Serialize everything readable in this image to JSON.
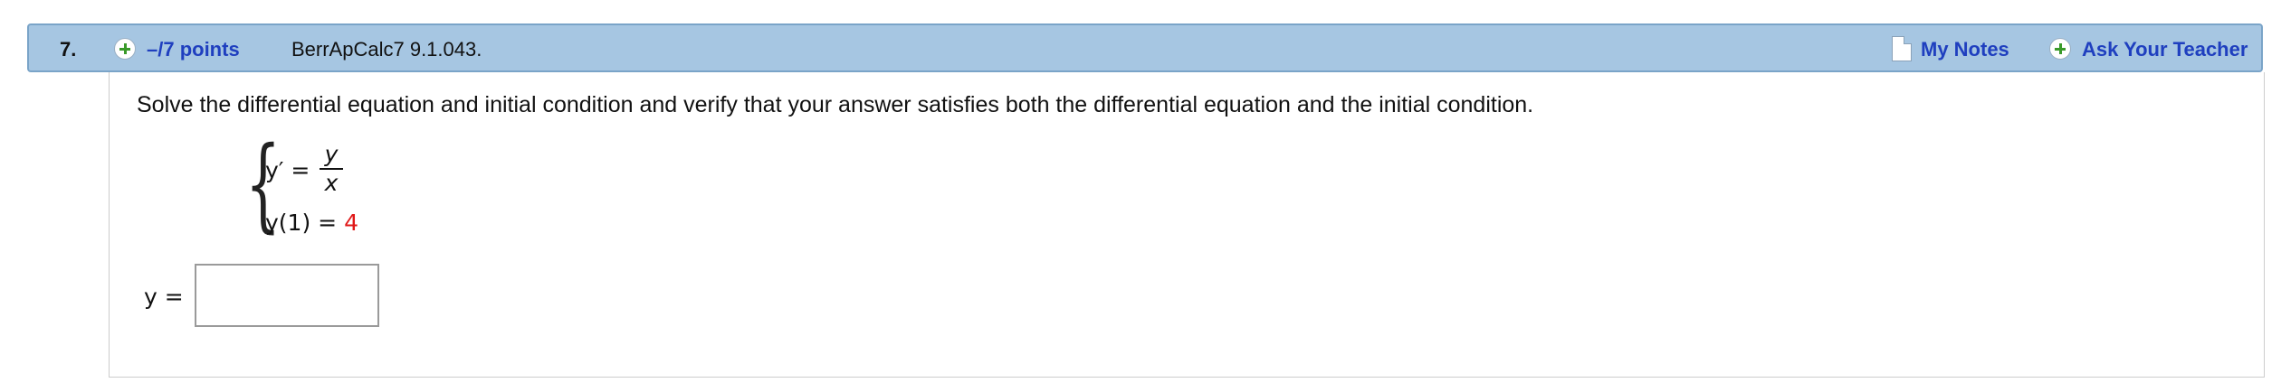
{
  "question": {
    "number": "7.",
    "points_label": "–/7 points",
    "source_id": "BerrApCalc7 9.1.043.",
    "my_notes_label": "My Notes",
    "ask_teacher_label": "Ask Your Teacher"
  },
  "prompt": "Solve the differential equation and initial condition and verify that your answer satisfies both the differential equation and the initial condition.",
  "system": {
    "brace": "{",
    "eq1_lhs": "y′ =",
    "frac_num": "y",
    "frac_den": "x",
    "eq2_lhs": "y(1) =",
    "eq2_value": "4"
  },
  "answer": {
    "label": "y =",
    "value": "",
    "placeholder": ""
  },
  "colors": {
    "header_bg": "#a6c6e2",
    "link": "#1f3fbf",
    "initial_value": "#e01818",
    "plus_icon": "#3a9a2a"
  },
  "icons": {
    "points": "plus-circle-icon",
    "notes": "note-page-icon",
    "ask_teacher": "plus-circle-icon"
  }
}
